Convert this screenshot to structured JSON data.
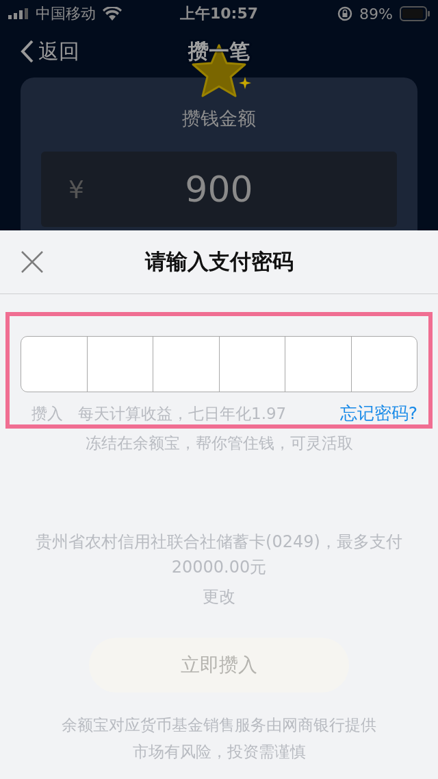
{
  "status_bar": {
    "carrier": "中国移动",
    "time": "上午10:57",
    "battery": "89%"
  },
  "nav": {
    "back": "返回",
    "title": "攒一笔"
  },
  "amount_card": {
    "label": "攒钱金额",
    "currency": "¥",
    "value": "900"
  },
  "payment_sheet": {
    "title": "请输入支付密码",
    "digits": [
      {
        "filled": false
      },
      {
        "filled": false
      },
      {
        "filled": false
      },
      {
        "filled": false
      },
      {
        "filled": false
      },
      {
        "filled": false
      }
    ],
    "forgot_link": "忘记密码?"
  },
  "background": {
    "deposit_label": "攒入",
    "yield_note": "每天计算收益，七日年化1.97",
    "freeze_note": "冻结在余额宝，帮你管住钱，可灵活取",
    "card_info": "贵州省农村信用社联合社储蓄卡(0249)，最多支付20000.00元",
    "change_link": "更改",
    "submit_button": "立即攒入",
    "disclaimer": [
      "余额宝对应货币基金销售服务由网商银行提供",
      "市场有风险，投资需谨慎"
    ]
  }
}
